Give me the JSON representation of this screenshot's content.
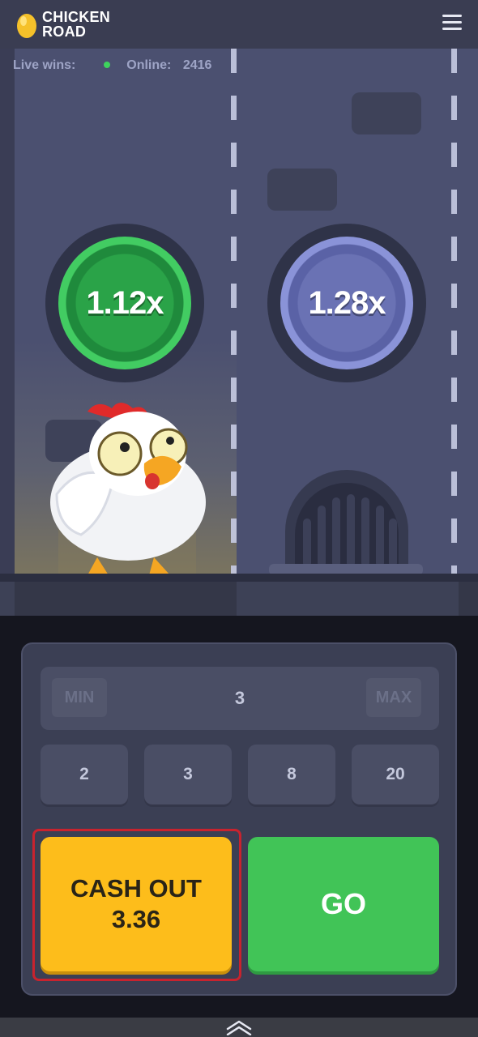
{
  "header": {
    "logo_line1": "CHICKEN",
    "logo_line2": "ROAD",
    "menu_icon": "hamburger-menu-icon"
  },
  "scene": {
    "live_wins_label": "Live wins:",
    "online_label": "Online:",
    "online_count": "2416",
    "current_multiplier": "1.12x",
    "next_multiplier": "1.28x"
  },
  "controls": {
    "min_label": "MIN",
    "max_label": "MAX",
    "stepper_value": "3",
    "quick_values": [
      "2",
      "3",
      "8",
      "20"
    ],
    "cashout_label": "CASH OUT",
    "cashout_amount": "3.36",
    "go_label": "GO"
  },
  "colors": {
    "header_bg": "#3a3d52",
    "road": "#4b5070",
    "current_coin": "#2aa348",
    "next_coin": "#6a72b4",
    "cashout": "#fdbd1b",
    "go": "#41c457",
    "highlight_border": "#c8232e"
  },
  "icons": {
    "expand": "chevron-up-icon",
    "logo": "golden-egg-icon"
  }
}
